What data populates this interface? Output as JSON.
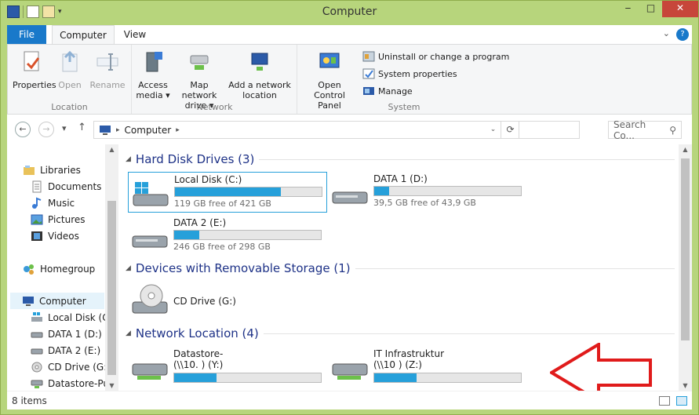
{
  "window": {
    "title": "Computer"
  },
  "ribbon": {
    "tabs": [
      "File",
      "Computer",
      "View"
    ],
    "groups": {
      "location": {
        "label": "Location",
        "buttons": {
          "properties": "Properties",
          "open": "Open",
          "rename": "Rename"
        }
      },
      "network": {
        "label": "Network",
        "buttons": {
          "access_media": [
            "Access",
            "media ▾"
          ],
          "map_drive": [
            "Map network",
            "drive ▾"
          ],
          "add_location": [
            "Add a network",
            "location"
          ]
        }
      },
      "system": {
        "label": "System",
        "buttons": {
          "control_panel": [
            "Open Control",
            "Panel"
          ],
          "uninstall": "Uninstall or change a program",
          "sys_props": "System properties",
          "manage": "Manage"
        }
      }
    }
  },
  "address": {
    "crumb": "Computer",
    "search_placeholder": "Search Co..."
  },
  "nav_pane": {
    "items": [
      "Libraries",
      "Documents",
      "Music",
      "Pictures",
      "Videos",
      "Homegroup",
      "Computer",
      "Local Disk (C:)",
      "DATA 1 (D:)",
      "DATA 2 (E:)",
      "CD Drive (G:)",
      "Datastore-Pus"
    ]
  },
  "sections": {
    "hdd": "Hard Disk Drives (3)",
    "removable": "Devices with Removable Storage (1)",
    "network": "Network Location (4)"
  },
  "drives": {
    "c": {
      "name": "Local Disk (C:)",
      "free": "119 GB free of 421 GB",
      "used_fraction": 0.72
    },
    "d": {
      "name": "DATA 1 (D:)",
      "free": "39,5 GB free of 43,9 GB",
      "used_fraction": 0.1
    },
    "e": {
      "name": "DATA 2 (E:)",
      "free": "246 GB free of 298 GB",
      "used_fraction": 0.17
    },
    "g": {
      "name": "CD Drive (G:)"
    },
    "y": {
      "name": "Datastore-",
      "path": "(\\\\10.                    ) (Y:)",
      "used_fraction": 0.29
    },
    "z": {
      "name": "IT Infrastruktur",
      "path": "(\\\\10                    ) (Z:)",
      "used_fraction": 0.29
    }
  },
  "status": {
    "items": "8 items"
  },
  "colors": {
    "accent": "#26a0da",
    "title_bar": "#b7d57c",
    "annotation_arrow": "#e01b1b"
  }
}
